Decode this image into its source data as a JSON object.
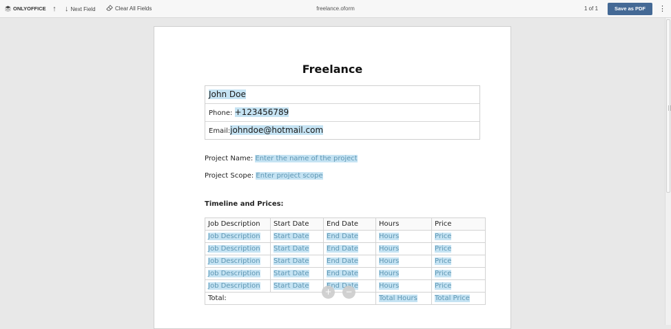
{
  "toolbar": {
    "logo_text": "ONLYOFFICE",
    "prev_icon": "arrow-up-icon",
    "next_field_label": "Next Field",
    "clear_all_label": "Clear All Fields",
    "document_title": "freelance.oform",
    "page_indicator": "1 of 1",
    "save_label": "Save as PDF",
    "more_icon": "vertical-dots-icon",
    "more_glyph": "⋮"
  },
  "form": {
    "title": "Freelance",
    "contact": {
      "name_value": "John Doe",
      "phone_label": "Phone:",
      "phone_value": "+123456789",
      "email_label": "Email:",
      "email_value": "johndoe@hotmail.com"
    },
    "project_name_label": "Project Name:",
    "project_name_placeholder": "Enter the name of the project",
    "project_scope_label": "Project Scope:",
    "project_scope_placeholder": "Enter project scope",
    "timeline_heading": "Timeline and Prices:",
    "table": {
      "headers": [
        "Job Description",
        "Start Date",
        "End Date",
        "Hours",
        "Price"
      ],
      "rows": [
        [
          "Job Description",
          "Start Date",
          "End Date",
          "Hours",
          "Price"
        ],
        [
          "Job Description",
          "Start Date",
          "End Date",
          "Hours",
          "Price"
        ],
        [
          "Job Description",
          "Start Date",
          "End Date",
          "Hours",
          "Price"
        ],
        [
          "Job Description",
          "Start Date",
          "End Date",
          "Hours",
          "Price"
        ],
        [
          "Job Description",
          "Start Date",
          "End Date",
          "Hours",
          "Price"
        ]
      ],
      "total_label": "Total:",
      "total_hours": "Total Hours",
      "total_price": "Total Price"
    },
    "add_row_glyph": "+",
    "remove_row_glyph": "−"
  },
  "colors": {
    "accent": "#446995",
    "field_highlight": "#c5e3f3",
    "placeholder_text": "#5e96b3"
  }
}
